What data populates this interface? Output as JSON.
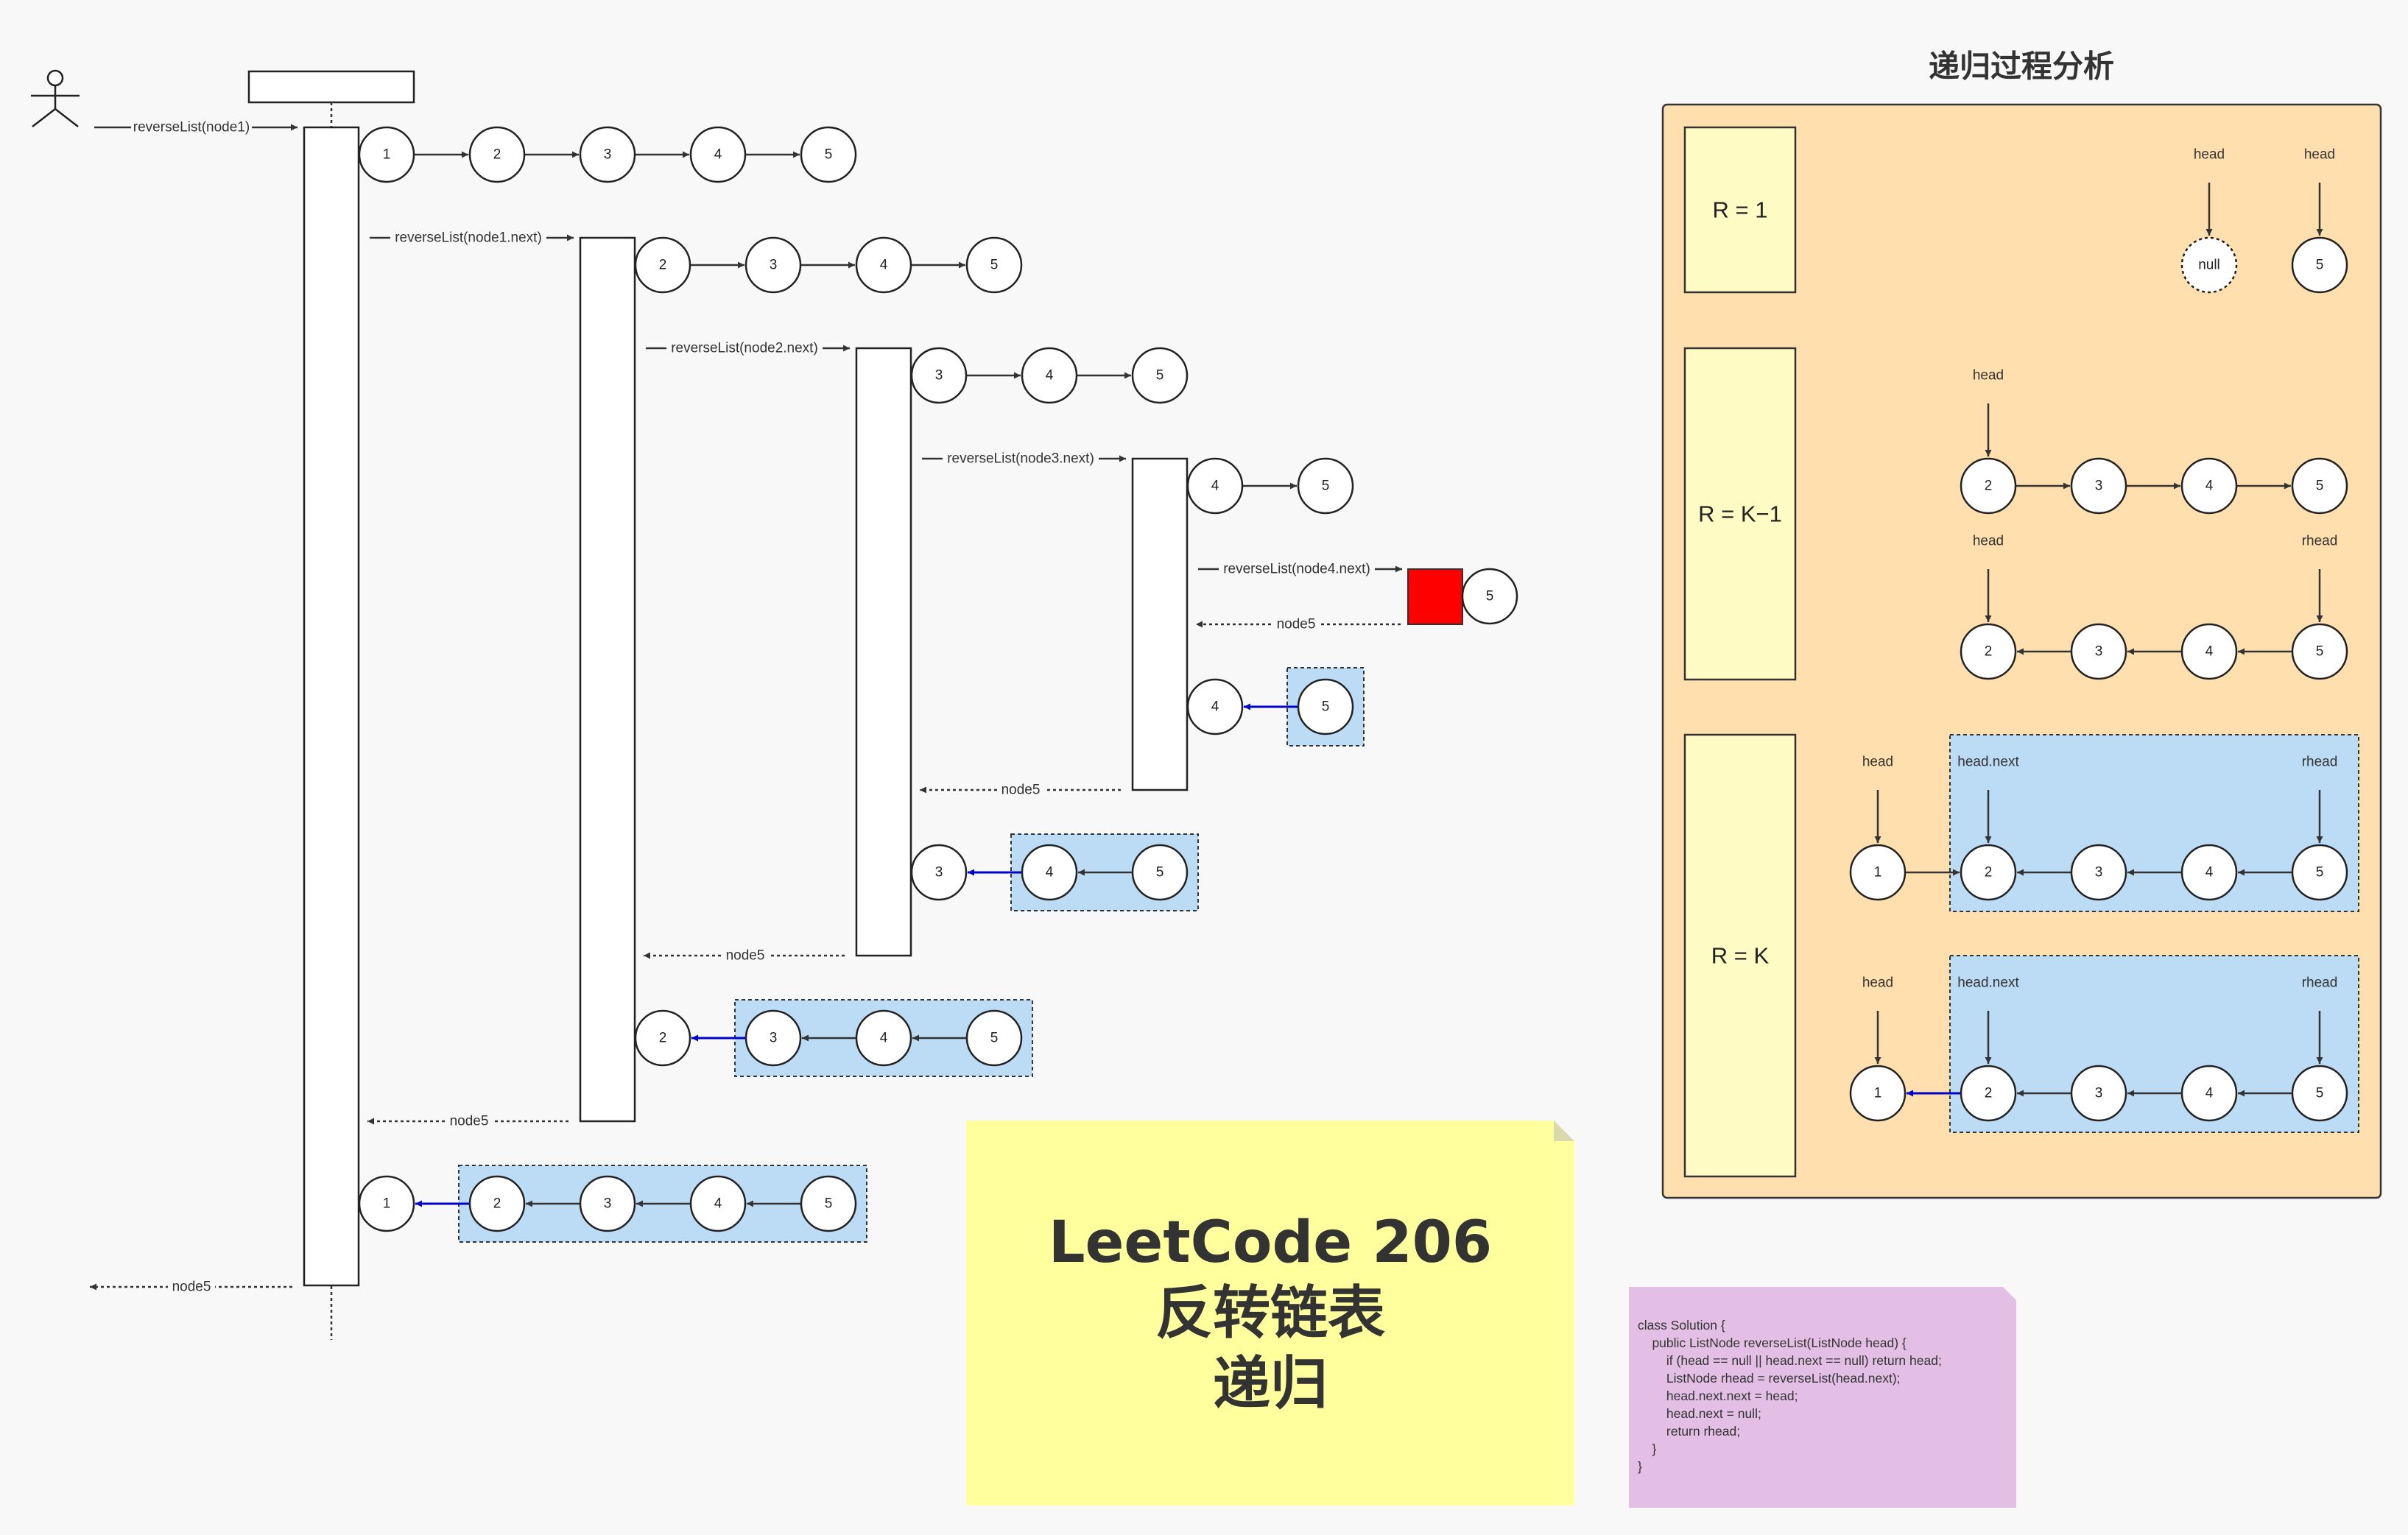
{
  "panel": {
    "title": "递归过程分析",
    "rows": [
      {
        "label": "R = 1"
      },
      {
        "label": "R = K−1"
      },
      {
        "label": "R = K"
      }
    ],
    "r1": {
      "pointer_left": "head",
      "pointer_right": "head",
      "null_label": "null",
      "node_right": "5"
    },
    "rk1": {
      "chain1": {
        "pointer": "head",
        "nodes": [
          "2",
          "3",
          "4",
          "5"
        ]
      },
      "chain2": {
        "pointer_left": "head",
        "pointer_right": "rhead",
        "nodes": [
          "2",
          "3",
          "4",
          "5"
        ]
      }
    },
    "rk": {
      "chain1": {
        "pointer_head": "head",
        "pointer_next": "head.next",
        "pointer_rhead": "rhead",
        "nodes": [
          "1",
          "2",
          "3",
          "4",
          "5"
        ]
      },
      "chain2": {
        "pointer_head": "head",
        "pointer_next": "head.next",
        "pointer_rhead": "rhead",
        "nodes": [
          "1",
          "2",
          "3",
          "4",
          "5"
        ]
      }
    }
  },
  "sequence": {
    "calls": [
      {
        "label": "reverseList(node1)",
        "nodes": [
          "1",
          "2",
          "3",
          "4",
          "5"
        ]
      },
      {
        "label": "reverseList(node1.next)",
        "nodes": [
          "2",
          "3",
          "4",
          "5"
        ]
      },
      {
        "label": "reverseList(node2.next)",
        "nodes": [
          "3",
          "4",
          "5"
        ]
      },
      {
        "label": "reverseList(node3.next)",
        "nodes": [
          "4",
          "5"
        ]
      },
      {
        "label": "reverseList(node4.next)",
        "nodes": [
          "5"
        ]
      }
    ],
    "return_label": "node5",
    "partial_results": [
      {
        "nodes": [
          "4",
          "5"
        ]
      },
      {
        "nodes": [
          "3",
          "4",
          "5"
        ]
      },
      {
        "nodes": [
          "2",
          "3",
          "4",
          "5"
        ]
      },
      {
        "nodes": [
          "1",
          "2",
          "3",
          "4",
          "5"
        ]
      }
    ]
  },
  "note": {
    "line1": "LeetCode 206",
    "line2": "反转链表",
    "line3": "递归"
  },
  "code": "class Solution {\n    public ListNode reverseList(ListNode head) {\n        if (head == null || head.next == null) return head;\n        ListNode rhead = reverseList(head.next);\n        head.next.next = head;\n        head.next = null;\n        return rhead;\n    }\n}",
  "colors": {
    "panel_bg": "#ffdfad",
    "row_label_bg": "#fffbc4",
    "highlight_bg": "#bcdcf6",
    "blue_arrow": "#0000cc",
    "base_case_box": "#ff0000",
    "note_bg": "#ffff9e",
    "code_bg": "#e3bfe6"
  }
}
